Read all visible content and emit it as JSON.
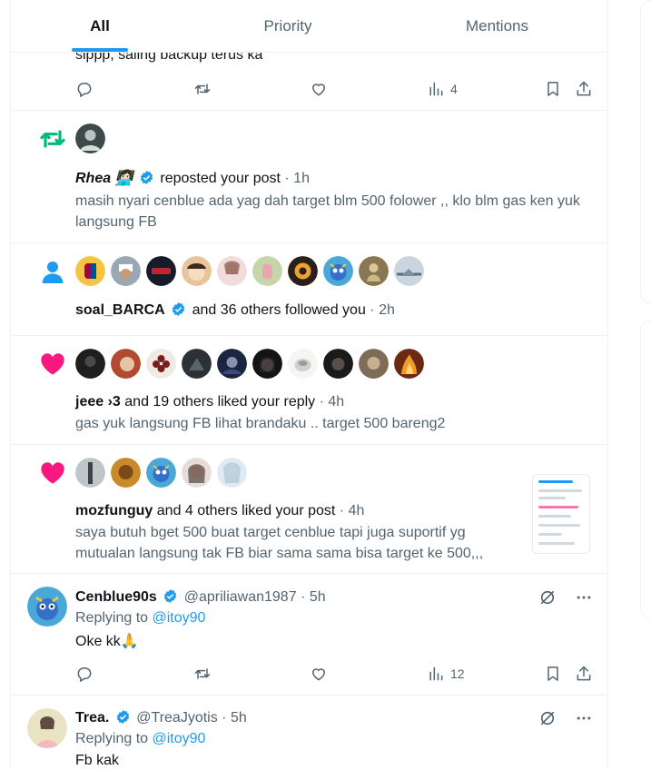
{
  "tabs": [
    {
      "label": "All",
      "active": true
    },
    {
      "label": "Priority",
      "active": false
    },
    {
      "label": "Mentions",
      "active": false
    }
  ],
  "top_reply": {
    "text": "sippp, saling backup terus ka",
    "views": "4"
  },
  "repost": {
    "user": "Rhea 👩🏻‍💻",
    "action": "reposted your post",
    "time": "· 1h",
    "text": "masih nyari cenblue ada yag dah target blm 500 folower ,, klo blm gas ken yuk langsung FB"
  },
  "follows": {
    "user": "soal_BARCA",
    "action": "and 36 others followed you",
    "time": "· 2h"
  },
  "like1": {
    "user": "jeee ›3",
    "action": "and 19 others liked your reply",
    "time": "· 4h",
    "text": "gas yuk langsung FB lihat brandaku .. target 500 bareng2"
  },
  "like2": {
    "user": "mozfunguy",
    "action": "and 4 others liked your post",
    "time": "· 4h",
    "text": "saya butuh bget 500 buat target cenblue tapi juga suportif yg mutualan langsung tak FB biar sama sama bisa target ke 500,,,"
  },
  "reply1": {
    "name": "Cenblue90s",
    "handle": "@apriliawan1987",
    "time": "· 5h",
    "replying": "Replying to",
    "mention": "@itoy90",
    "text": "Oke kk🙏",
    "views": "12"
  },
  "reply2": {
    "name": "Trea.",
    "handle": "@TreaJyotis",
    "time": "· 5h",
    "replying": "Replying to",
    "mention": "@itoy90",
    "text": "Fb kak"
  },
  "colors": {
    "accent": "#1d9bf0",
    "repost_green": "#00ba7c",
    "like_pink": "#f91880",
    "muted": "#536471"
  },
  "icons": [
    "reply-icon",
    "retweet-icon",
    "like-icon",
    "views-icon",
    "bookmark-icon",
    "share-icon",
    "follow-person-icon",
    "heart-icon",
    "grok-icon",
    "more-icon",
    "verified-icon"
  ]
}
